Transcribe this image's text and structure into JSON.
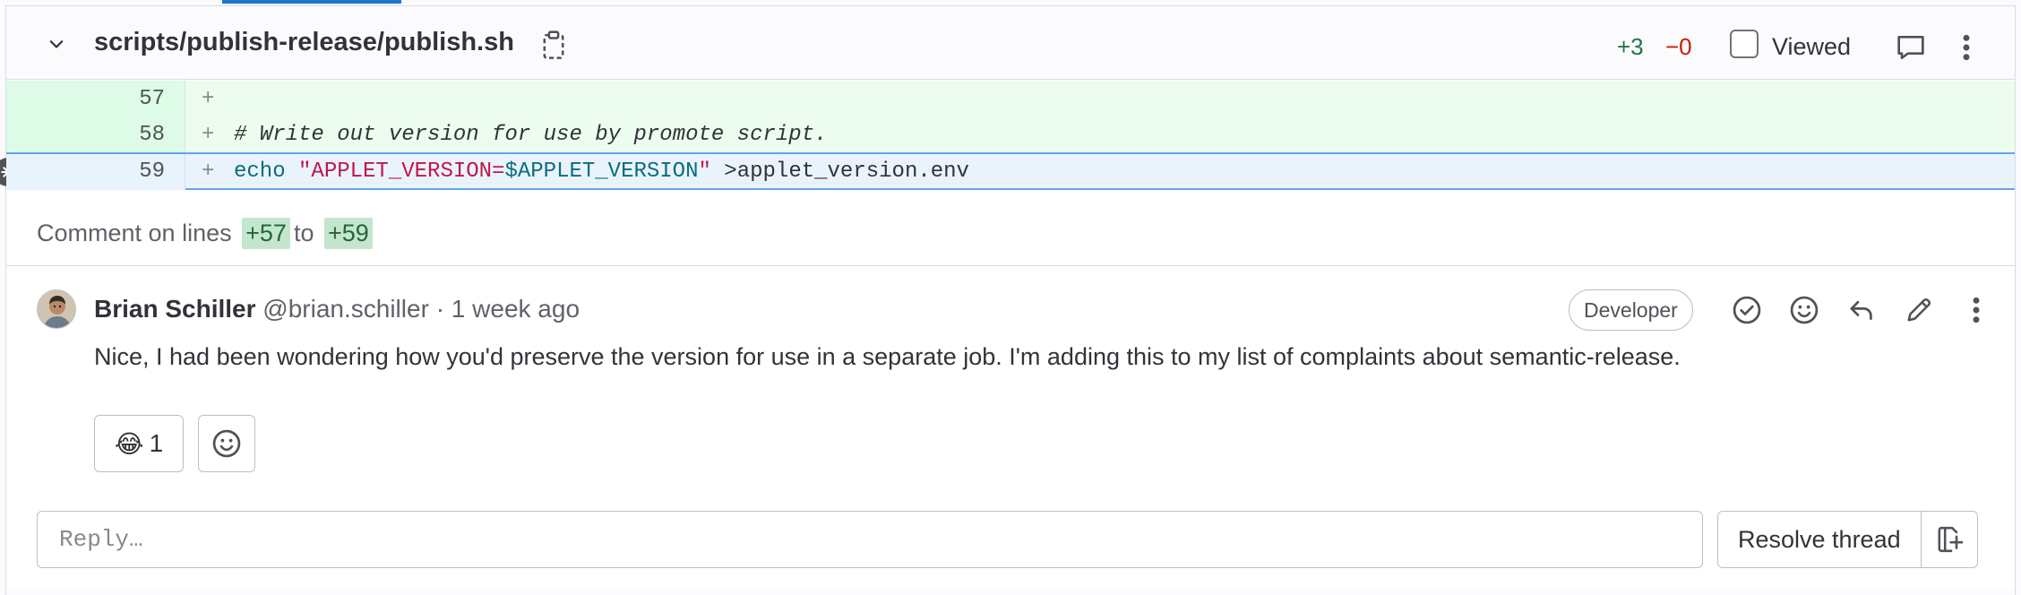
{
  "file": {
    "path": "scripts/publish-release/publish.sh",
    "additions": "+3",
    "deletions": "−0",
    "viewed_label": "Viewed",
    "icons": {
      "collapse": "chevron-down-icon",
      "copy": "copy-to-clipboard-icon",
      "comment": "comment-icon",
      "more": "ellipsis-v-icon"
    }
  },
  "diff": {
    "lines": [
      {
        "num": "57",
        "sign": "+",
        "code": ""
      },
      {
        "num": "58",
        "sign": "+",
        "code": "# Write out version for use by promote script."
      },
      {
        "num": "59",
        "sign": "+",
        "code_kw": "echo ",
        "code_str_a": "\"APPLET_VERSION=",
        "code_var": "$APPLET_VERSION",
        "code_str_b": "\"",
        "code_rest": " >applet_version.env"
      }
    ]
  },
  "comment_on": {
    "prefix": "Comment on lines",
    "start": "+57",
    "middle": "to",
    "end": "+59"
  },
  "note": {
    "author_name": "Brian Schiller",
    "author_handle": "@brian.schiller",
    "separator": "·",
    "time": "1 week ago",
    "role": "Developer",
    "body": "Nice, I had been wondering how you'd preserve the version for use in a separate job. I'm adding this to my list of complaints about semantic-release.",
    "reaction_emoji": "😂",
    "reaction_count": "1",
    "actions": [
      "resolve-check-icon",
      "add-reaction-icon",
      "reply-icon",
      "edit-pencil-icon",
      "ellipsis-v-icon"
    ]
  },
  "reply": {
    "placeholder": "Reply…",
    "resolve_label": "Resolve thread"
  },
  "colors": {
    "added_bg": "#ecfdf0",
    "selected_bg": "#e9f3fc",
    "accent": "#1f75cb",
    "addition_text": "#217645",
    "deletion_text": "#c91c00"
  }
}
